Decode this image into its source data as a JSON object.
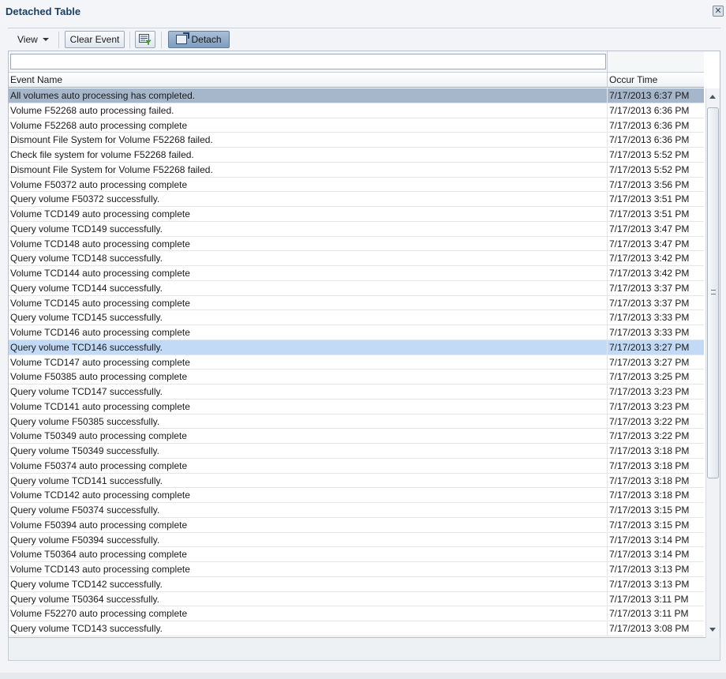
{
  "window": {
    "title": "Detached Table",
    "close_icon": "close-icon"
  },
  "toolbar": {
    "view_label": "View",
    "clear_event_label": "Clear Event",
    "filter_icon": "filter-icon",
    "detach_label": "Detach"
  },
  "table": {
    "columns": [
      "Event Name",
      "Occur Time"
    ],
    "rows": [
      [
        "All volumes auto processing has completed.",
        "7/17/2013 6:37 PM"
      ],
      [
        "Volume F52268 auto processing failed.",
        "7/17/2013 6:36 PM"
      ],
      [
        "Volume F52268 auto processing complete",
        "7/17/2013 6:36 PM"
      ],
      [
        "Dismount File System for Volume F52268 failed.",
        "7/17/2013 6:36 PM"
      ],
      [
        "Check file system for volume F52268 failed.",
        "7/17/2013 5:52 PM"
      ],
      [
        "Dismount File System for Volume F52268 failed.",
        "7/17/2013 5:52 PM"
      ],
      [
        "Volume F50372 auto processing complete",
        "7/17/2013 3:56 PM"
      ],
      [
        "Query volume F50372 successfully.",
        "7/17/2013 3:51 PM"
      ],
      [
        "Volume TCD149 auto processing complete",
        "7/17/2013 3:51 PM"
      ],
      [
        "Query volume TCD149 successfully.",
        "7/17/2013 3:47 PM"
      ],
      [
        "Volume TCD148 auto processing complete",
        "7/17/2013 3:47 PM"
      ],
      [
        "Query volume TCD148 successfully.",
        "7/17/2013 3:42 PM"
      ],
      [
        "Volume TCD144 auto processing complete",
        "7/17/2013 3:42 PM"
      ],
      [
        "Query volume TCD144 successfully.",
        "7/17/2013 3:37 PM"
      ],
      [
        "Volume TCD145 auto processing complete",
        "7/17/2013 3:37 PM"
      ],
      [
        "Query volume TCD145 successfully.",
        "7/17/2013 3:33 PM"
      ],
      [
        "Volume TCD146 auto processing complete",
        "7/17/2013 3:33 PM"
      ],
      [
        "Query volume TCD146 successfully.",
        "7/17/2013 3:27 PM"
      ],
      [
        "Volume TCD147 auto processing complete",
        "7/17/2013 3:27 PM"
      ],
      [
        "Volume F50385 auto processing complete",
        "7/17/2013 3:25 PM"
      ],
      [
        "Query volume TCD147 successfully.",
        "7/17/2013 3:23 PM"
      ],
      [
        "Volume TCD141 auto processing complete",
        "7/17/2013 3:23 PM"
      ],
      [
        "Query volume F50385 successfully.",
        "7/17/2013 3:22 PM"
      ],
      [
        "Volume T50349 auto processing complete",
        "7/17/2013 3:22 PM"
      ],
      [
        "Query volume T50349 successfully.",
        "7/17/2013 3:18 PM"
      ],
      [
        "Volume F50374 auto processing complete",
        "7/17/2013 3:18 PM"
      ],
      [
        "Query volume TCD141 successfully.",
        "7/17/2013 3:18 PM"
      ],
      [
        "Volume TCD142 auto processing complete",
        "7/17/2013 3:18 PM"
      ],
      [
        "Query volume F50374 successfully.",
        "7/17/2013 3:15 PM"
      ],
      [
        "Volume F50394 auto processing complete",
        "7/17/2013 3:15 PM"
      ],
      [
        "Query volume F50394 successfully.",
        "7/17/2013 3:14 PM"
      ],
      [
        "Volume T50364 auto processing complete",
        "7/17/2013 3:14 PM"
      ],
      [
        "Volume TCD143 auto processing complete",
        "7/17/2013 3:13 PM"
      ],
      [
        "Query volume TCD142 successfully.",
        "7/17/2013 3:13 PM"
      ],
      [
        "Query volume T50364 successfully.",
        "7/17/2013 3:11 PM"
      ],
      [
        "Volume F52270 auto processing complete",
        "7/17/2013 3:11 PM"
      ],
      [
        "Query volume TCD143 successfully.",
        "7/17/2013 3:08 PM"
      ]
    ],
    "selected_row_index": 0,
    "hover_row_index": 17
  },
  "colors": {
    "title": "#1d3f66",
    "selected_row": "#a7b7cb",
    "hover_row": "#c2daf6"
  }
}
